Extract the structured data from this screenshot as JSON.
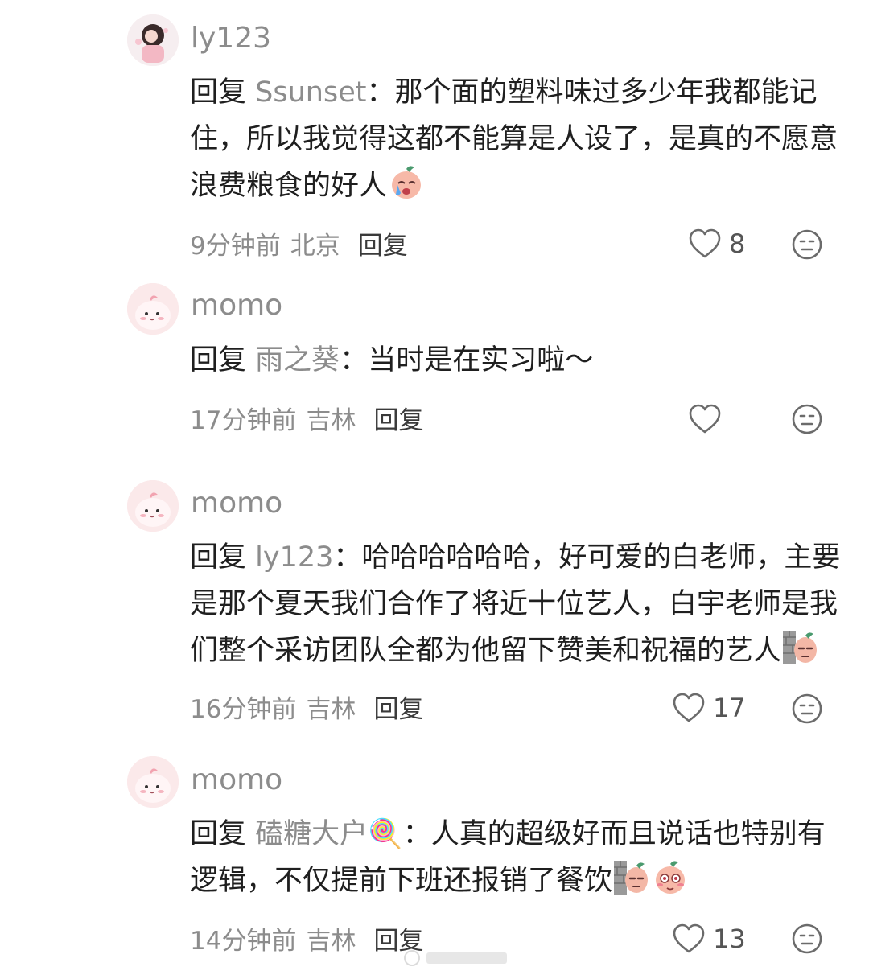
{
  "comments": [
    {
      "username": "ly123",
      "reply_prefix": "回复",
      "mention": "Ssunset",
      "colon": "：",
      "text": "那个面的塑料味过多少年我都能记住，所以我觉得这都不能算是人设了，是真的不愿意浪费粮食的好人",
      "time": "9分钟前",
      "location": "北京",
      "reply_label": "回复",
      "likes": "8",
      "avatar": "user-avatar-ly123",
      "emojis": [
        "crying-sticker"
      ]
    },
    {
      "username": "momo",
      "reply_prefix": "回复",
      "mention": "雨之葵",
      "colon": "：",
      "text": "当时是在实习啦～",
      "time": "17分钟前",
      "location": "吉林",
      "reply_label": "回复",
      "likes": "",
      "avatar": "user-avatar-momo",
      "emojis": []
    },
    {
      "username": "momo",
      "reply_prefix": "回复",
      "mention": "ly123",
      "colon": "：",
      "text": "哈哈哈哈哈哈，好可爱的白老师，主要是那个夏天我们合作了将近十位艺人，白宇老师是我们整个采访团队全都为他留下赞美和祝福的艺人",
      "time": "16分钟前",
      "location": "吉林",
      "reply_label": "回复",
      "likes": "17",
      "avatar": "user-avatar-momo",
      "emojis": [
        "peeking-wall-sticker"
      ]
    },
    {
      "username": "momo",
      "reply_prefix": "回复",
      "mention": "磕糖大户🍭",
      "colon": "：",
      "text": "人真的超级好而且说话也特别有逻辑，不仅提前下班还报销了餐饮",
      "time": "14分钟前",
      "location": "吉林",
      "reply_label": "回复",
      "likes": "13",
      "avatar": "user-avatar-momo",
      "emojis": [
        "peeking-wall-sticker",
        "shy-sticker"
      ]
    }
  ],
  "colors": {
    "text": "#1f1f1f",
    "muted": "#8c8c8c",
    "icon": "#6b6b6b",
    "avatar_bg": "#fbe9ea"
  }
}
